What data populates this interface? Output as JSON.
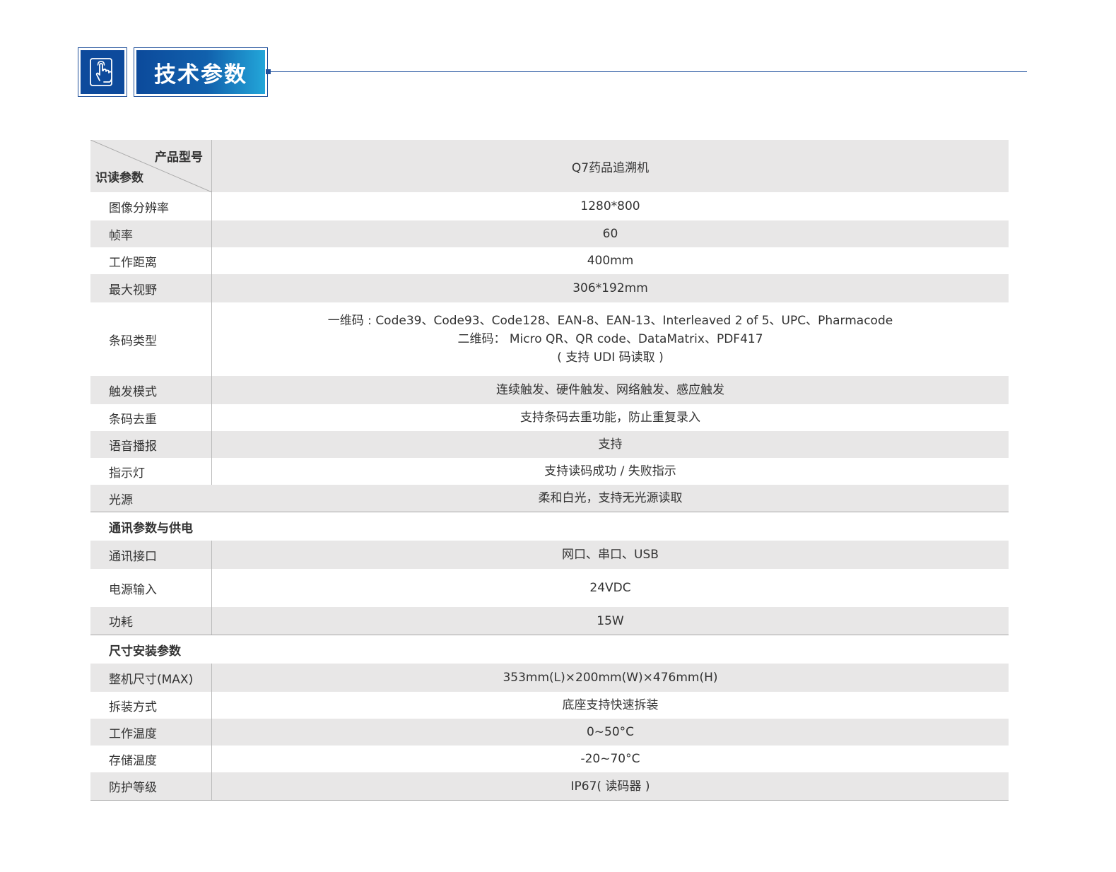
{
  "header": {
    "title": "技术参数",
    "icon": "touch-hand-icon"
  },
  "table": {
    "head": {
      "model_label": "产品型号",
      "param_label": "识读参数",
      "model_value": "Q7药品追溯机"
    },
    "reading": [
      {
        "label": "图像分辨率",
        "value": "1280*800"
      },
      {
        "label": "帧率",
        "value": "60"
      },
      {
        "label": "工作距离",
        "value": "400mm"
      },
      {
        "label": "最大视野",
        "value": "306*192mm"
      }
    ],
    "barcode": {
      "label": "条码类型",
      "lines": [
        "一维码 : Code39、Code93、Code128、EAN-8、EAN-13、Interleaved 2 of 5、UPC、Pharmacode",
        "二维码： Micro QR、QR code、DataMatrix、PDF417",
        "( 支持 UDI 码读取 )"
      ]
    },
    "reading2": [
      {
        "label": "触发模式",
        "value": "连续触发、硬件触发、网络触发、感应触发"
      },
      {
        "label": "条码去重",
        "value": "支持条码去重功能，防止重复录入"
      },
      {
        "label": "语音播报",
        "value": "支持"
      },
      {
        "label": "指示灯",
        "value": "支持读码成功 / 失败指示"
      },
      {
        "label": "光源",
        "value": "柔和白光，支持无光源读取"
      }
    ],
    "comm_section": "通讯参数与供电",
    "comm": [
      {
        "label": "通讯接口",
        "value": "网口、串口、USB"
      },
      {
        "label": "电源输入",
        "value": "24VDC"
      },
      {
        "label": "功耗",
        "value": "15W"
      }
    ],
    "size_section": "尺寸安装参数",
    "size": [
      {
        "label": "整机尺寸(MAX)",
        "value": "353mm(L)×200mm(W)×476mm(H)"
      },
      {
        "label": "拆装方式",
        "value": "底座支持快速拆装"
      },
      {
        "label": "工作温度",
        "value": "0~50°C"
      },
      {
        "label": "存储温度",
        "value": "-20~70°C"
      },
      {
        "label": "防护等级",
        "value": "IP67( 读码器 )"
      }
    ]
  }
}
